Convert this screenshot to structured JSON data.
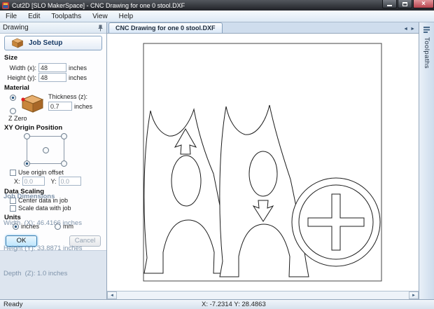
{
  "window": {
    "title": "Cut2D [SLO MakerSpace] - CNC Drawing for one 0 stool.DXF"
  },
  "menu": {
    "items": [
      {
        "label": "File"
      },
      {
        "label": "Edit"
      },
      {
        "label": "Toolpaths"
      },
      {
        "label": "View"
      },
      {
        "label": "Help"
      }
    ]
  },
  "drawing_panel": {
    "title": "Drawing",
    "job_setup_label": "Job Setup",
    "size": {
      "heading": "Size",
      "width_label": "Width (x):",
      "width_value": "48",
      "height_label": "Height (y):",
      "height_value": "48",
      "units_suffix": "inches"
    },
    "material": {
      "heading": "Material",
      "thickness_label": "Thickness (z):",
      "thickness_value": "0.7",
      "units_suffix": "inches",
      "z_zero_label": "Z Zero"
    },
    "xy_origin": {
      "heading": "XY Origin Position"
    },
    "origin_offset": {
      "checkbox_label": "Use origin offset",
      "x_label": "X:",
      "x_value": "0.0",
      "y_label": "Y:",
      "y_value": "0.0"
    },
    "data_scaling": {
      "heading": "Data Scaling",
      "center_label": "Center data in job",
      "scale_label": "Scale data with job"
    },
    "units": {
      "heading": "Units",
      "inches_label": "inches",
      "mm_label": "mm"
    },
    "buttons": {
      "ok": "OK",
      "cancel": "Cancel"
    },
    "job_dimensions": {
      "heading": "Job Dimensions",
      "rows": [
        "Width  (X): 46.4166 inches",
        "Height (Y): 33.8871 inches",
        "Depth  (Z): 1.0 inches"
      ]
    }
  },
  "document": {
    "tab_label": "CNC Drawing for one 0 stool.DXF"
  },
  "toolpaths_tab": {
    "label": "Toolpaths"
  },
  "status_bar": {
    "ready": "Ready",
    "coordinates": "X: -7.2314 Y: 28.4863"
  },
  "colors": {
    "titlebar": "#24262b",
    "close_button": "#b8434d",
    "selection_blue": "#1f4e79",
    "panel_dim_text": "#7e93aa"
  }
}
